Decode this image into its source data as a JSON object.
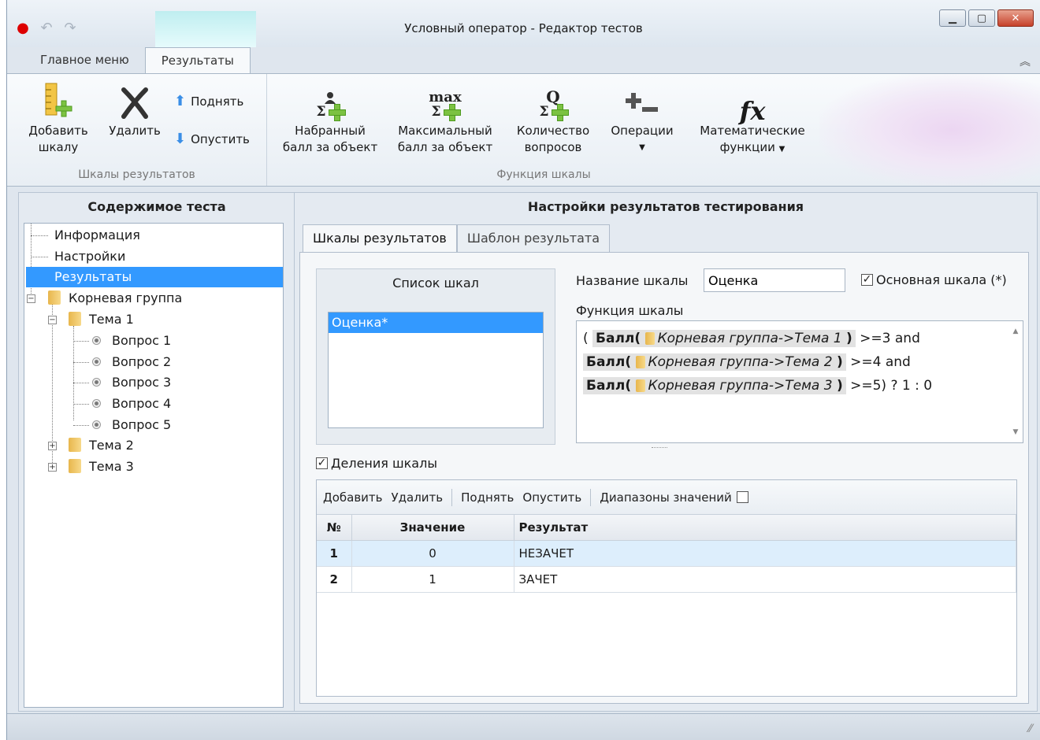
{
  "window": {
    "title": "Условный оператор - Редактор тестов",
    "controls": [
      "minimize",
      "maximize",
      "close"
    ]
  },
  "ribbon_tabs": [
    "Главное меню",
    "Результаты"
  ],
  "ribbon": {
    "group1": {
      "label": "Шкалы результатов",
      "add": "Добавить шкалу",
      "add_line1": "Добавить",
      "add_line2": "шкалу",
      "delete": "Удалить",
      "up": "Поднять",
      "down": "Опустить"
    },
    "group2": {
      "label": "Функция шкалы",
      "score_line1": "Набранный",
      "score_line2": "балл за объект",
      "max_line1": "Максимальный",
      "max_line2": "балл за объект",
      "count_line1": "Количество",
      "count_line2": "вопросов",
      "operations": "Операции",
      "math_line1": "Математические",
      "math_line2": "функции",
      "max_icon_text": "max",
      "q_icon_text": "Q",
      "sigma": "Σ",
      "fx": "fx"
    }
  },
  "left_panel": {
    "title": "Содержимое теста",
    "tree": {
      "info": "Информация",
      "settings": "Настройки",
      "results": "Результаты",
      "root": "Корневая группа",
      "topic1": "Тема 1",
      "q1": "Вопрос 1",
      "q2": "Вопрос 2",
      "q3": "Вопрос 3",
      "q4": "Вопрос 4",
      "q5": "Вопрос 5",
      "topic2": "Тема 2",
      "topic3": "Тема 3"
    }
  },
  "right_panel": {
    "title": "Настройки результатов тестирования",
    "tabs": [
      "Шкалы результатов",
      "Шаблон результата"
    ],
    "scales_list_title": "Список шкал",
    "scales": [
      "Оценка*"
    ],
    "scale_name_label": "Название шкалы",
    "scale_name_value": "Оценка",
    "main_scale_label": "Основная шкала (*)",
    "main_scale_checked": true,
    "function_label": "Функция шкалы",
    "function": {
      "open_paren": "(",
      "fn": "Балл(",
      "close": ")",
      "path1": "Корневая группа->Тема 1",
      "op1": ">=3 and",
      "path2": "Корневая группа->Тема 2",
      "op2": ">=4 and",
      "path3": "Корневая группа->Тема 3",
      "op3": ">=5) ? 1 : 0"
    },
    "divisions_label": "Деления шкалы",
    "divisions_checked": true,
    "grid_toolbar": {
      "add": "Добавить",
      "delete": "Удалить",
      "up": "Поднять",
      "down": "Опустить",
      "ranges": "Диапазоны значений"
    },
    "grid": {
      "headers": [
        "№",
        "Значение",
        "Результат"
      ],
      "rows": [
        {
          "num": "1",
          "value": "0",
          "result": "НЕЗАЧЕТ"
        },
        {
          "num": "2",
          "value": "1",
          "result": "ЗАЧЕТ"
        }
      ]
    }
  },
  "icons": {
    "check": "✓",
    "expander_minus": "−",
    "expander_plus": "+",
    "collapse": "︽",
    "grip": "⁄⁄"
  }
}
